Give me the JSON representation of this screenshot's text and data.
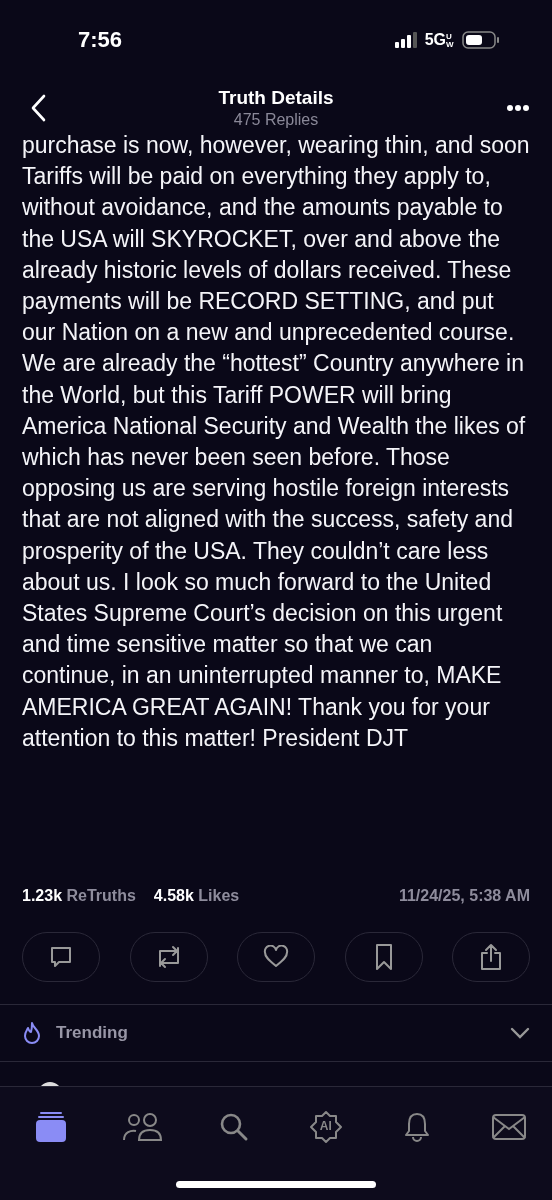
{
  "status_bar": {
    "time": "7:56",
    "network": "5G",
    "network_sub": "UW"
  },
  "header": {
    "title": "Truth Details",
    "subtitle": "475 Replies"
  },
  "post": {
    "text": "purchase is now, however, wearing thin, and soon Tariffs will be paid on everything they apply to, without avoidance, and the amounts payable to the USA will SKYROCKET, over and above the already historic levels of dollars received. These payments will be RECORD SETTING, and put our Nation on a new and unprecedented course. We are already the “hottest” Country anywhere in the World, but this Tariff POWER will bring America National Security and Wealth the likes of which has never been seen before. Those opposing us are serving hostile foreign interests that are not aligned with the success, safety and prosperity of the USA. They couldn’t care less about us. I look so much forward to the United States Supreme Court’s decision on this urgent and time sensitive matter so that we can continue, in an uninterrupted manner to, MAKE AMERICA GREAT AGAIN! Thank you for your attention to this matter! President DJT"
  },
  "stats": [
    {
      "count": "1.23k",
      "label": "ReTruths"
    },
    {
      "count": "4.58k",
      "label": "Likes"
    }
  ],
  "timestamp": "11/24/25, 5:38 AM",
  "actions": [
    {
      "kind": "reply"
    },
    {
      "kind": "retruth"
    },
    {
      "kind": "like"
    },
    {
      "kind": "bookmark"
    },
    {
      "kind": "share"
    }
  ],
  "trending": {
    "label": "Trending",
    "expanded": false
  },
  "nav": [
    {
      "kind": "home",
      "selected": true
    },
    {
      "kind": "groups",
      "selected": false
    },
    {
      "kind": "search",
      "selected": false
    },
    {
      "kind": "ai",
      "selected": false,
      "label": "AI"
    },
    {
      "kind": "notifications",
      "selected": false
    },
    {
      "kind": "messages",
      "selected": false
    }
  ]
}
